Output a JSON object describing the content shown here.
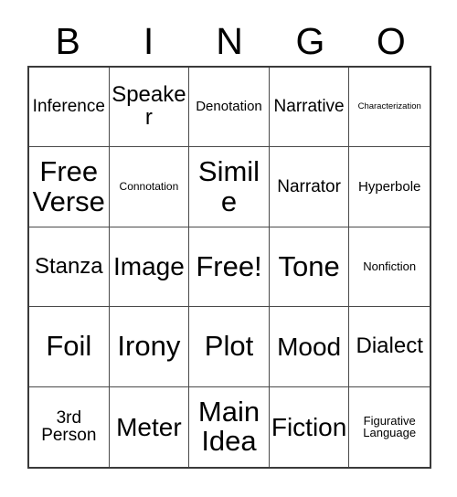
{
  "header": {
    "letters": [
      "B",
      "I",
      "N",
      "G",
      "O"
    ]
  },
  "grid": {
    "rows": 5,
    "columns": 5,
    "border_color": "#3a3a3a",
    "background_color": "#ffffff",
    "text_color": "#000000",
    "cells": [
      {
        "label": "Inference",
        "size": "md"
      },
      {
        "label": "Speaker",
        "size": "lg"
      },
      {
        "label": "Denotation",
        "size": "sm"
      },
      {
        "label": "Narrative",
        "size": "md"
      },
      {
        "label": "Characterization",
        "size": "tiny"
      },
      {
        "label": "Free Verse",
        "size": "xxl"
      },
      {
        "label": "Connotation",
        "size": "xxs"
      },
      {
        "label": "Simile",
        "size": "xxl"
      },
      {
        "label": "Narrator",
        "size": "md"
      },
      {
        "label": "Hyperbole",
        "size": "sm"
      },
      {
        "label": "Stanza",
        "size": "lg"
      },
      {
        "label": "Image",
        "size": "xl"
      },
      {
        "label": "Free!",
        "size": "xxl"
      },
      {
        "label": "Tone",
        "size": "xxl"
      },
      {
        "label": "Nonfiction",
        "size": "xs"
      },
      {
        "label": "Foil",
        "size": "xxl"
      },
      {
        "label": "Irony",
        "size": "xxl"
      },
      {
        "label": "Plot",
        "size": "xxl"
      },
      {
        "label": "Mood",
        "size": "xl"
      },
      {
        "label": "Dialect",
        "size": "lg"
      },
      {
        "label": "3rd Person",
        "size": "md"
      },
      {
        "label": "Meter",
        "size": "xl"
      },
      {
        "label": "Main Idea",
        "size": "xxl"
      },
      {
        "label": "Fiction",
        "size": "xl"
      },
      {
        "label": "Figurative Language",
        "size": "xs"
      }
    ]
  }
}
